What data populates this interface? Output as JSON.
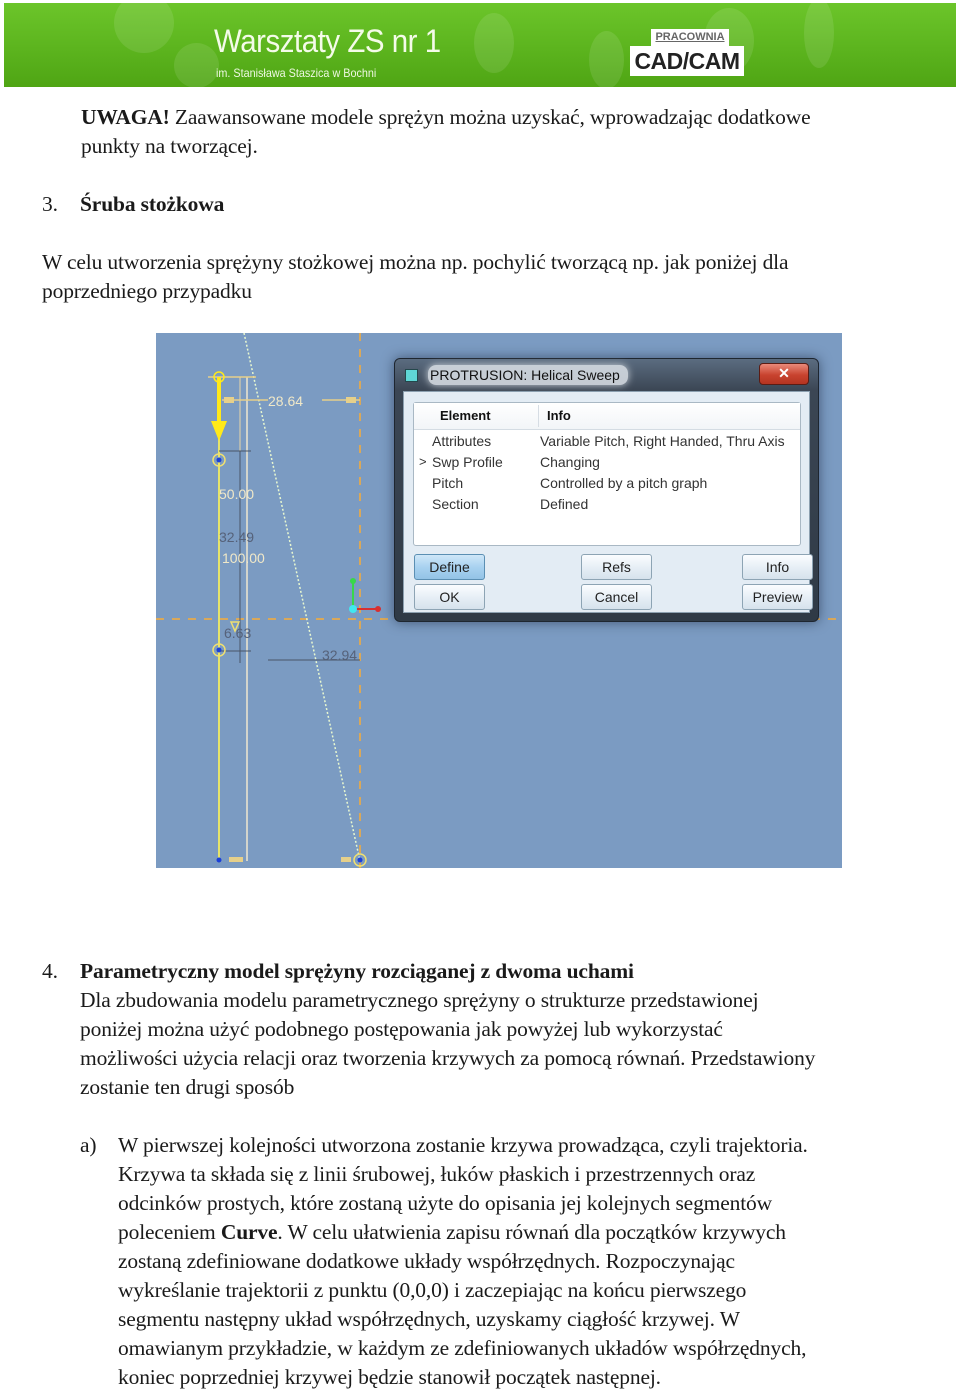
{
  "header": {
    "title": "Warsztaty ZS nr 1",
    "subtitle": "im. Stanisława Staszica w Bochni",
    "badge_top": "PRACOWNIA",
    "badge_main": "CAD/CAM",
    "colors": {
      "banner": "#5cb41e",
      "badge_bg": "#ffffff"
    }
  },
  "document": {
    "note": {
      "label": "UWAGA!",
      "line1": " Zaawansowane modele sprężyn można uzyskać, wprowadzając dodatkowe",
      "line2": "punkty na tworzącej."
    },
    "section3": {
      "number": "3.",
      "title": "Śruba stożkowa",
      "text_line1": "W celu utworzenia sprężyny stożkowej można np. pochylić tworzącą np. jak poniżej dla",
      "text_line2": "poprzedniego przypadku"
    },
    "section4": {
      "number": "4.",
      "title": "Parametryczny model sprężyny rozciąganej z dwoma uchami",
      "lines": [
        "Dla zbudowania modelu parametrycznego sprężyny o strukturze przedstawionej",
        "poniżej można użyć podobnego postępowania jak powyżej lub wykorzystać",
        "możliwości użycia relacji oraz tworzenia krzywych za pomocą równań. Przedstawiony",
        "zostanie ten drugi sposób"
      ],
      "item_a": {
        "marker": "a)",
        "line1": "W pierwszej kolejności utworzona zostanie krzywa prowadząca, czyli trajektoria.",
        "line2": "Krzywa ta składa się z linii śrubowej, łuków płaskich i przestrzennych oraz",
        "line3": "odcinków prostych, które zostaną użyte do opisania jej kolejnych segmentów",
        "line4_pre": "poleceniem ",
        "line4_bold": "Curve",
        "line4_post": ". W celu ułatwienia zapisu równań dla początków krzywych",
        "line5": "zostaną zdefiniowane dodatkowe układy współrzędnych. Rozpoczynając",
        "line6": "wykreślanie trajektorii z punktu (0,0,0) i zaczepiając na końcu pierwszego",
        "line7": "segmentu następny układ współrzędnych, uzyskamy ciągłość krzywej. W",
        "line8": "omawianym przykładzie, w każdym ze zdefiniowanych układów współrzędnych,",
        "line9": "koniec poprzedniej krzywej będzie stanowił początek następnej."
      }
    }
  },
  "cad_screenshot": {
    "background": "#7b9bc2",
    "dimensions": {
      "d1": "28.64",
      "d2": "50.00",
      "d3": "32.49",
      "d4": "100.00",
      "d5": "6.63",
      "d6": "32.94"
    },
    "dialog": {
      "title": "PROTRUSION: Helical Sweep",
      "close_glyph": "✕",
      "columns": {
        "element": "Element",
        "info": "Info"
      },
      "rows": [
        {
          "marker": "",
          "element": "Attributes",
          "info": "Variable Pitch, Right Handed, Thru Axis"
        },
        {
          "marker": ">",
          "element": "Swp Profile",
          "info": "Changing"
        },
        {
          "marker": "",
          "element": "Pitch",
          "info": "Controlled by a pitch graph"
        },
        {
          "marker": "",
          "element": "Section",
          "info": "Defined"
        }
      ],
      "buttons": {
        "define": "Define",
        "refs": "Refs",
        "info": "Info",
        "ok": "OK",
        "cancel": "Cancel",
        "preview": "Preview"
      }
    }
  }
}
